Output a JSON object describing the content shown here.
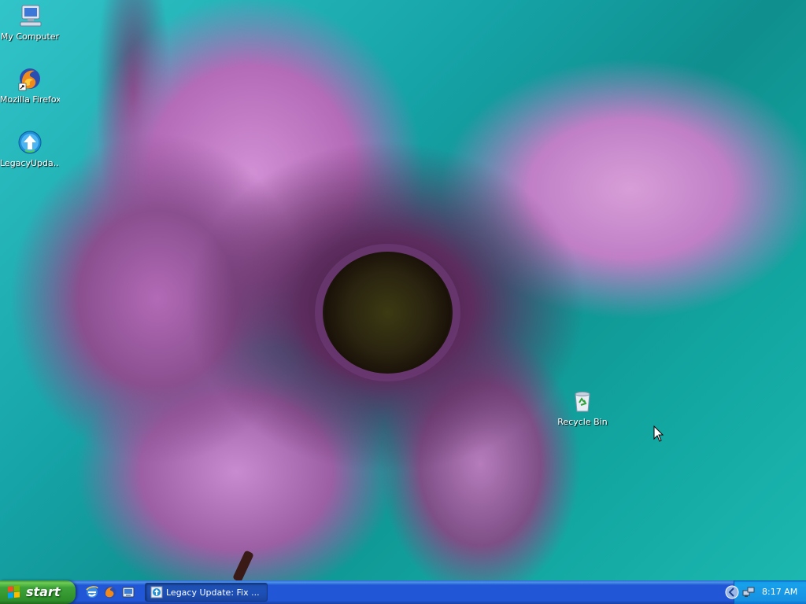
{
  "desktop": {
    "icons": [
      {
        "label": "My Computer",
        "icon": "computer-icon"
      },
      {
        "label": "Mozilla Firefox",
        "icon": "firefox-icon"
      },
      {
        "label": "LegacyUpda...",
        "icon": "legacy-update-icon"
      },
      {
        "label": "Recycle Bin",
        "icon": "recycle-bin-icon"
      }
    ]
  },
  "taskbar": {
    "start_label": "start",
    "quick_launch": [
      "internet-explorer-icon",
      "firefox-icon",
      "show-desktop-icon"
    ],
    "task_items": [
      {
        "label": "Legacy Update: Fix ...",
        "icon": "legacy-update-icon"
      }
    ],
    "tray": {
      "clock": "8:17 AM",
      "icons": [
        "chevron-left-icon",
        "network-icon"
      ]
    }
  },
  "colors": {
    "taskbar": "#2157d7",
    "start": "#3ea339",
    "tray": "#1591e2"
  }
}
